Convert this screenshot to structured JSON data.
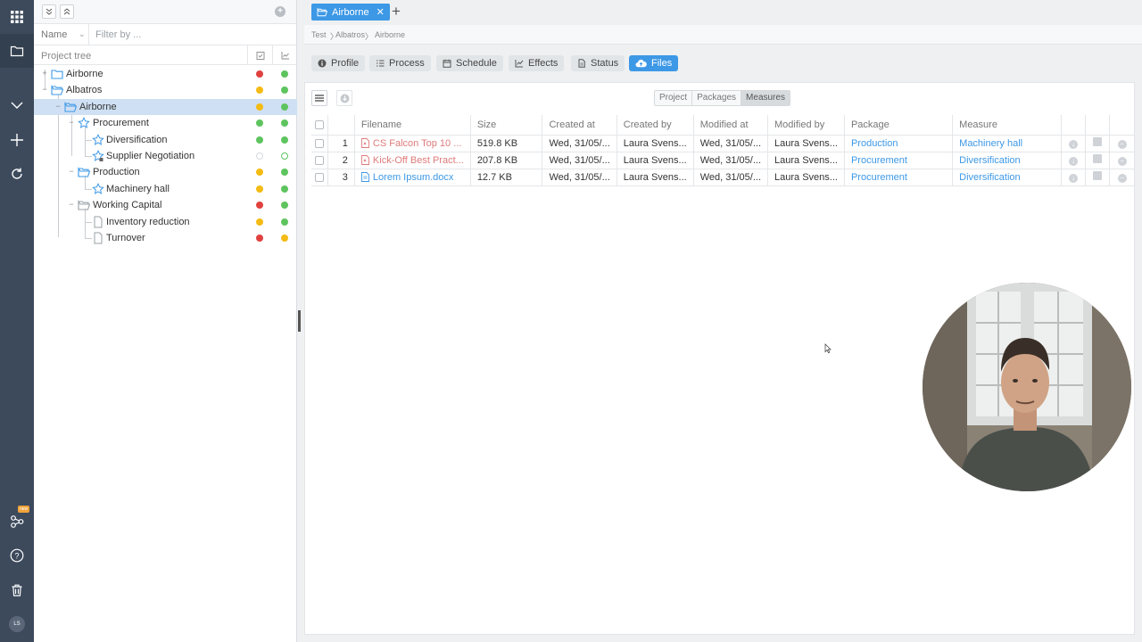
{
  "rail": {
    "badge": "new",
    "avatar": "LS",
    "icons": [
      "apps-grid-icon",
      "folder-icon",
      "chevron-down-icon",
      "plus-icon",
      "refresh-icon",
      "share-nodes-icon",
      "help-icon",
      "trash-icon"
    ]
  },
  "tree_panel": {
    "filter": {
      "field_label": "Name",
      "placeholder": "Filter by ..."
    },
    "header_label": "Project tree",
    "items": [
      {
        "label": "Airborne",
        "status1": "red",
        "status2": "green"
      },
      {
        "label": "Albatros",
        "status1": "yellow",
        "status2": "green"
      },
      {
        "label": "Airborne",
        "status1": "yellow",
        "status2": "green",
        "selected": true
      },
      {
        "label": "Procurement",
        "status1": "green",
        "status2": "green"
      },
      {
        "label": "Diversification",
        "status1": "green",
        "status2": "green"
      },
      {
        "label": "Supplier Negotiation",
        "status1": "none",
        "status2": "blocked"
      },
      {
        "label": "Production",
        "status1": "yellow",
        "status2": "green"
      },
      {
        "label": "Machinery hall",
        "status1": "yellow",
        "status2": "green"
      },
      {
        "label": "Working Capital",
        "status1": "red",
        "status2": "green"
      },
      {
        "label": "Inventory reduction",
        "status1": "yellow",
        "status2": "green"
      },
      {
        "label": "Turnover",
        "status1": "red",
        "status2": "yellow"
      }
    ]
  },
  "tabs": [
    {
      "label": "Airborne",
      "close": "✕"
    }
  ],
  "tab_add": "+",
  "breadcrumb": [
    "Test",
    "Albatros",
    "Airborne"
  ],
  "section_tabs": [
    {
      "label": "Profile",
      "icon": "info-icon"
    },
    {
      "label": "Process",
      "icon": "list-icon"
    },
    {
      "label": "Schedule",
      "icon": "calendar-icon"
    },
    {
      "label": "Effects",
      "icon": "chart-icon"
    },
    {
      "label": "Status",
      "icon": "document-icon"
    },
    {
      "label": "Files",
      "icon": "cloud-upload-icon",
      "active": true
    }
  ],
  "scope_filter": {
    "options": [
      "Project",
      "Packages",
      "Measures"
    ],
    "selected": "Measures"
  },
  "files_table": {
    "columns": [
      "Filename",
      "Size",
      "Created at",
      "Created by",
      "Modified at",
      "Modified by",
      "Package",
      "Measure"
    ],
    "rows": [
      {
        "index": "1",
        "filename": "CS Falcon Top 10 ...",
        "type": "pdf",
        "size": "519.8 KB",
        "created_at": "Wed, 31/05/...",
        "created_by": "Laura Svens...",
        "modified_at": "Wed, 31/05/...",
        "modified_by": "Laura Svens...",
        "package": "Production",
        "measure": "Machinery hall"
      },
      {
        "index": "2",
        "filename": "Kick-Off Best Pract...",
        "type": "pdf",
        "size": "207.8 KB",
        "created_at": "Wed, 31/05/...",
        "created_by": "Laura Svens...",
        "modified_at": "Wed, 31/05/...",
        "modified_by": "Laura Svens...",
        "package": "Procurement",
        "measure": "Diversification"
      },
      {
        "index": "3",
        "filename": "Lorem Ipsum.docx",
        "type": "doc",
        "size": "12.7 KB",
        "created_at": "Wed, 31/05/...",
        "created_by": "Laura Svens...",
        "modified_at": "Wed, 31/05/...",
        "modified_by": "Laura Svens...",
        "package": "Procurement",
        "measure": "Diversification"
      }
    ]
  },
  "colors": {
    "accent": "#3d98e6",
    "rail": "#3d4a5c",
    "red": "#e0413f",
    "yellow": "#f4bb14",
    "green": "#5ec45f",
    "pdf": "#e07a7a"
  }
}
